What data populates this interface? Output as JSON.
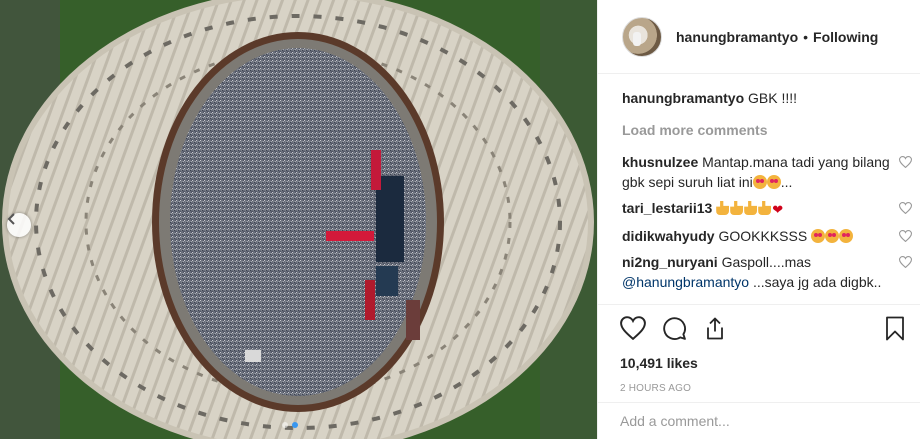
{
  "post": {
    "username": "hanungbramantyo",
    "separator": "•",
    "follow_status": "Following",
    "caption_user": "hanungbramantyo",
    "caption_text": "GBK !!!!",
    "load_more": "Load more comments",
    "likes": "10,491 likes",
    "time": "2 HOURS AGO",
    "add_comment_placeholder": "Add a comment..."
  },
  "comments": [
    {
      "user": "khusnulzee",
      "text": "Mantap.mana tadi yang bilang gbk sepi suruh liat ini",
      "trail": "..."
    },
    {
      "user": "tari_lestarii13",
      "text": ""
    },
    {
      "user": "didikwahyudy",
      "text": "GOOKKKSSS"
    },
    {
      "user": "ni2ng_nuryani",
      "text": "Gaspoll....mas",
      "mention": "@hanungbramantyo",
      "text2": "...saya jg ada digbk.."
    }
  ],
  "carousel": {
    "total": 2,
    "active": 1
  },
  "colors": {
    "accent": "#3897f0",
    "mention": "#003569",
    "muted": "#999999"
  },
  "icons": [
    "chevron-left-icon",
    "heart-icon",
    "comment-icon",
    "share-icon",
    "bookmark-icon"
  ]
}
